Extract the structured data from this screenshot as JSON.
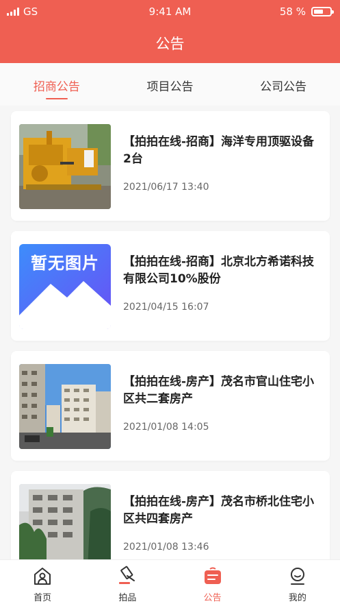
{
  "status_bar": {
    "carrier": "GS",
    "time": "9:41 AM",
    "battery": "58 %",
    "battery_level": 0.58
  },
  "header": {
    "title": "公告"
  },
  "tabs": [
    {
      "label": "招商公告",
      "active": true
    },
    {
      "label": "项目公告",
      "active": false
    },
    {
      "label": "公司公告",
      "active": false
    }
  ],
  "notices": [
    {
      "title": "【拍拍在线-招商】海洋专用顶驱设备2台",
      "date": "2021/06/17 13:40",
      "image": "drilling-equipment-photo"
    },
    {
      "title": "【拍拍在线-招商】北京北方希诺科技有限公司10%股份",
      "date": "2021/04/15 16:07",
      "image": "no-image-placeholder",
      "placeholder_text": "暂无图片"
    },
    {
      "title": "【拍拍在线-房产】茂名市官山住宅小区共二套房产",
      "date": "2021/01/08 14:05",
      "image": "residential-buildings-photo"
    },
    {
      "title": "【拍拍在线-房产】茂名市桥北住宅小区共四套房产",
      "date": "2021/01/08 13:46",
      "image": "apartment-building-photo"
    }
  ],
  "tab_bar": [
    {
      "label": "首页",
      "icon": "home-icon",
      "active": false
    },
    {
      "label": "拍品",
      "icon": "auction-hammer-icon",
      "active": false
    },
    {
      "label": "公告",
      "icon": "notice-icon",
      "active": true
    },
    {
      "label": "我的",
      "icon": "profile-icon",
      "active": false
    }
  ],
  "colors": {
    "brand": "#ef5f52",
    "text": "#222222",
    "muted": "#666666",
    "background": "#f6f6f6"
  }
}
